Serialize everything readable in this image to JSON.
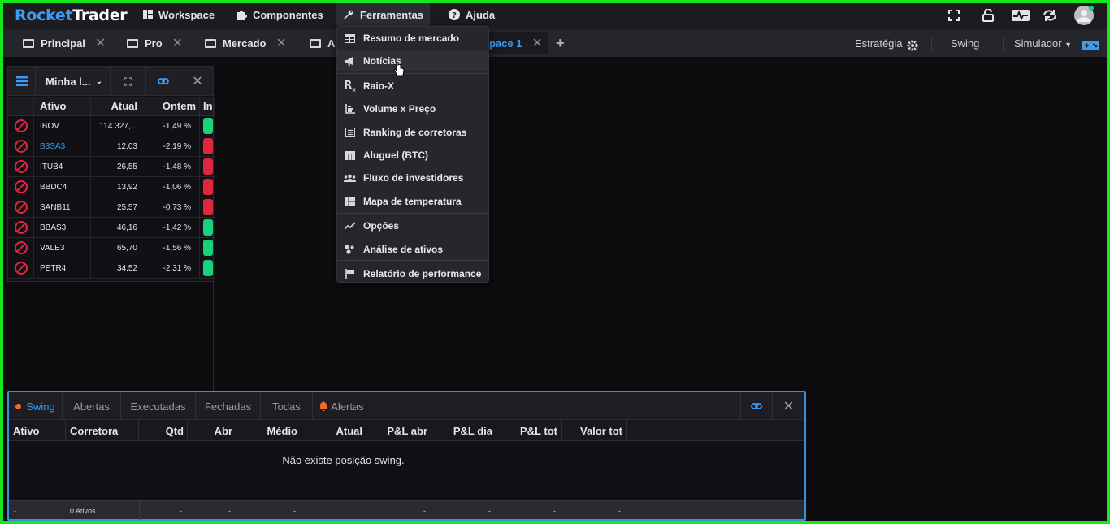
{
  "app": {
    "logo_a": "Rocket",
    "logo_b": "Trader"
  },
  "menus": [
    {
      "label": "Workspace",
      "icon": "layout-icon"
    },
    {
      "label": "Componentes",
      "icon": "puzzle-icon"
    },
    {
      "label": "Ferramentas",
      "icon": "wrench-icon"
    },
    {
      "label": "Ajuda",
      "icon": "help-icon"
    }
  ],
  "tabs": [
    "Principal",
    "Pro",
    "Mercado",
    "A",
    "pace 1"
  ],
  "right_tabs": {
    "estrategia": "Estratégia",
    "swing": "Swing",
    "simulador": "Simulador"
  },
  "watchlist": {
    "name": "Minha l...",
    "columns": [
      "Ativo",
      "Atual",
      "Ontem",
      "In"
    ],
    "rows": [
      {
        "ativo": "IBOV",
        "atual": "114.327,...",
        "ontem": "-1,49 %",
        "color": "#19d17a",
        "link": false
      },
      {
        "ativo": "B3SA3",
        "atual": "12,03",
        "ontem": "-2,19 %",
        "color": "#e0253e",
        "link": true
      },
      {
        "ativo": "ITUB4",
        "atual": "26,55",
        "ontem": "-1,48 %",
        "color": "#e0253e",
        "link": false
      },
      {
        "ativo": "BBDC4",
        "atual": "13,92",
        "ontem": "-1,06 %",
        "color": "#e0253e",
        "link": false
      },
      {
        "ativo": "SANB11",
        "atual": "25,57",
        "ontem": "-0,73 %",
        "color": "#e0253e",
        "link": false
      },
      {
        "ativo": "BBAS3",
        "atual": "46,16",
        "ontem": "-1,42 %",
        "color": "#19d17a",
        "link": false
      },
      {
        "ativo": "VALE3",
        "atual": "65,70",
        "ontem": "-1,56 %",
        "color": "#19d17a",
        "link": false
      },
      {
        "ativo": "PETR4",
        "atual": "34,52",
        "ontem": "-2,31 %",
        "color": "#19d17a",
        "link": false
      }
    ]
  },
  "dropdown": [
    {
      "label": "Resumo de mercado",
      "icon": "table-icon"
    },
    {
      "label": "Notícias",
      "icon": "megaphone-icon"
    },
    {
      "label": "Raio-X",
      "icon": "rx-icon"
    },
    {
      "label": "Volume x Preço",
      "icon": "volume-icon"
    },
    {
      "label": "Ranking de corretoras",
      "icon": "ranking-icon"
    },
    {
      "label": "Aluguel (BTC)",
      "icon": "grid-icon"
    },
    {
      "label": "Fluxo de investidores",
      "icon": "people-icon"
    },
    {
      "label": "Mapa de temperatura",
      "icon": "heatmap-icon"
    },
    {
      "label": "Opções",
      "icon": "chart-line-icon"
    },
    {
      "label": "Análise de ativos",
      "icon": "dots-icon"
    },
    {
      "label": "Relatório de performance",
      "icon": "flag-icon"
    }
  ],
  "positions": {
    "tabs": [
      "Swing",
      "Abertas",
      "Executadas",
      "Fechadas",
      "Todas",
      "Alertas"
    ],
    "columns": [
      "Ativo",
      "Corretora",
      "Qtd",
      "Abr",
      "Médio",
      "Atual",
      "P&L abr",
      "P&L dia",
      "P&L tot",
      "Valor tot"
    ],
    "empty": "Não existe posição swing.",
    "footer": [
      "-",
      "0 Ativos",
      "-",
      "-",
      "-",
      "-",
      "-",
      "-",
      "-"
    ]
  },
  "colors": {
    "accent": "#3d9bf0",
    "up": "#19d17a",
    "down": "#e0253e",
    "alert": "#f06a2a"
  }
}
